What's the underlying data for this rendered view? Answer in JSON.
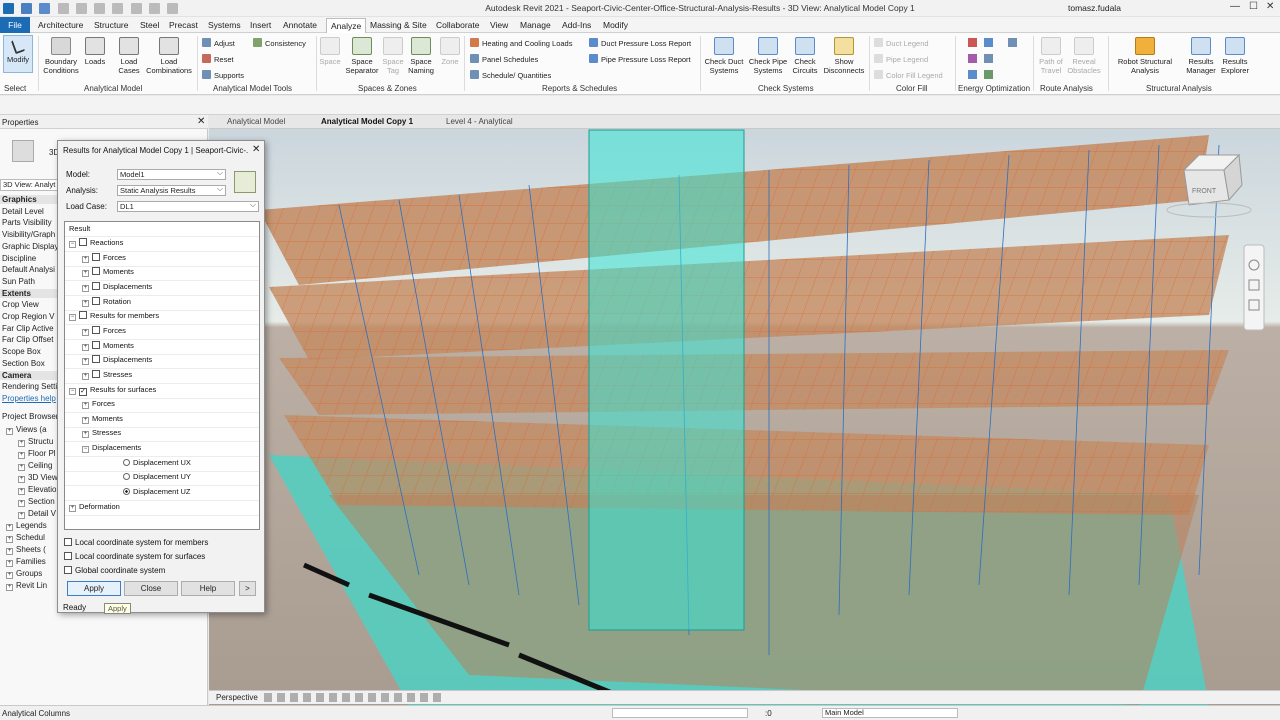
{
  "app_title": "Autodesk Revit 2021 - Seaport-Civic-Center-Office-Structural-Analysis-Results - 3D View: Analytical Model Copy 1",
  "user": "tomasz.fudala",
  "tabs": [
    "File",
    "Architecture",
    "Structure",
    "Steel",
    "Precast",
    "Systems",
    "Insert",
    "Annotate",
    "Analyze",
    "Massing & Site",
    "Collaborate",
    "View",
    "Manage",
    "Add-Ins",
    "Modify"
  ],
  "ribbon": {
    "modify": "Modify",
    "select": "Select",
    "boundary_conditions": "Boundary Conditions",
    "loads": "Loads",
    "load_cases": "Load Cases",
    "load_combinations": "Load Combinations",
    "analytical_model": "Analytical Model",
    "adjust": "Adjust",
    "consistency": "Consistency",
    "reset": "Reset",
    "supports": "Supports",
    "analytical_model_tools": "Analytical Model Tools",
    "space": "Space",
    "space_separator": "Space Separator",
    "space_tag": "Space Tag",
    "space_naming": "Space Naming",
    "zone": "Zone",
    "spaces_zones": "Spaces & Zones",
    "heating_cooling": "Heating and Cooling Loads",
    "panel_schedules": "Panel Schedules",
    "schedule_quantities": "Schedule/ Quantities",
    "duct_pressure": "Duct Pressure Loss Report",
    "pipe_pressure": "Pipe Pressure Loss Report",
    "reports_schedules": "Reports & Schedules",
    "check_duct": "Check Duct Systems",
    "check_pipe": "Check Pipe Systems",
    "check_circuits": "Check Circuits",
    "show_disconnects": "Show Disconnects",
    "check_systems": "Check Systems",
    "duct_legend": "Duct Legend",
    "pipe_legend": "Pipe Legend",
    "color_fill_legend": "Color Fill Legend",
    "color_fill": "Color Fill",
    "energy_optimization": "Energy Optimization",
    "path_of_travel": "Path of Travel",
    "reveal_obstacles": "Reveal Obstacles",
    "route_analysis": "Route Analysis",
    "robot": "Robot Structural Analysis",
    "results_manager": "Results Manager",
    "results_explorer": "Results Explorer",
    "structural_analysis": "Structural Analysis"
  },
  "properties": {
    "title": "Properties",
    "type_label": "3D",
    "selector": "3D View: Analyt",
    "rows": [
      {
        "t": "Graphics",
        "sec": true
      },
      {
        "t": "Detail Level"
      },
      {
        "t": "Parts Visibility"
      },
      {
        "t": "Visibility/Graph"
      },
      {
        "t": "Graphic Display"
      },
      {
        "t": "Discipline"
      },
      {
        "t": "Default Analysi"
      },
      {
        "t": "Sun Path"
      },
      {
        "t": "Extents",
        "sec": true
      },
      {
        "t": "Crop View"
      },
      {
        "t": "Crop Region V"
      },
      {
        "t": "Far Clip Active"
      },
      {
        "t": "Far Clip Offset"
      },
      {
        "t": "Scope Box"
      },
      {
        "t": "Section Box"
      },
      {
        "t": "Camera",
        "sec": true
      },
      {
        "t": "Rendering Setti"
      }
    ],
    "help": "Properties help",
    "browser_title": "Project Browser",
    "browser": [
      {
        "t": "Views (a",
        "lvl": 0
      },
      {
        "t": "Structu",
        "lvl": 1
      },
      {
        "t": "Floor Pl",
        "lvl": 1
      },
      {
        "t": "Ceiling",
        "lvl": 1
      },
      {
        "t": "3D View",
        "lvl": 1
      },
      {
        "t": "Elevatio",
        "lvl": 1
      },
      {
        "t": "Section",
        "lvl": 1
      },
      {
        "t": "Detail V",
        "lvl": 1
      },
      {
        "t": "Legends",
        "lvl": 0
      },
      {
        "t": "Schedul",
        "lvl": 0
      },
      {
        "t": "Sheets (",
        "lvl": 0
      },
      {
        "t": "Families",
        "lvl": 0
      },
      {
        "t": "Groups",
        "lvl": 0
      },
      {
        "t": "Revit Lin",
        "lvl": 0
      }
    ]
  },
  "view_tabs": [
    "Analytical Model",
    "Analytical Model Copy 1",
    "Level 4 - Analytical"
  ],
  "dialog": {
    "title": "Results for Analytical Model Copy 1 | Seaport-Civic-...",
    "model_label": "Model:",
    "model_value": "Model1",
    "analysis_label": "Analysis:",
    "analysis_value": "Static Analysis Results",
    "loadcase_label": "Load Case:",
    "loadcase_value": "DL1",
    "tree_header": "Result",
    "tree": [
      {
        "t": "Reactions",
        "lvl": 0,
        "exp": "-",
        "chk": "0"
      },
      {
        "t": "Forces",
        "lvl": 1,
        "exp": "+",
        "chk": "0"
      },
      {
        "t": "Moments",
        "lvl": 1,
        "exp": "+",
        "chk": "0"
      },
      {
        "t": "Displacements",
        "lvl": 1,
        "exp": "+",
        "chk": "0"
      },
      {
        "t": "Rotation",
        "lvl": 1,
        "exp": "+",
        "chk": "0"
      },
      {
        "t": "Results for members",
        "lvl": 0,
        "exp": "-",
        "chk": "0"
      },
      {
        "t": "Forces",
        "lvl": 1,
        "exp": "+",
        "chk": "0"
      },
      {
        "t": "Moments",
        "lvl": 1,
        "exp": "+",
        "chk": "0"
      },
      {
        "t": "Displacements",
        "lvl": 1,
        "exp": "+",
        "chk": "0"
      },
      {
        "t": "Stresses",
        "lvl": 1,
        "exp": "+",
        "chk": "0"
      },
      {
        "t": "Results for surfaces",
        "lvl": 0,
        "exp": "-",
        "chk": "1"
      },
      {
        "t": "Forces",
        "lvl": 1,
        "exp": "+"
      },
      {
        "t": "Moments",
        "lvl": 1,
        "exp": "+"
      },
      {
        "t": "Stresses",
        "lvl": 1,
        "exp": "+"
      },
      {
        "t": "Displacements",
        "lvl": 1,
        "exp": "-"
      },
      {
        "t": "Displacement UX",
        "lvl": 2,
        "rad": "0"
      },
      {
        "t": "Displacement UY",
        "lvl": 2,
        "rad": "0"
      },
      {
        "t": "Displacement UZ",
        "lvl": 2,
        "rad": "1"
      },
      {
        "t": "Deformation",
        "lvl": 0,
        "exp": "+"
      }
    ],
    "opt_members": "Local coordinate system for members",
    "opt_surfaces": "Local coordinate system for surfaces",
    "opt_global": "Global coordinate system",
    "apply": "Apply",
    "close": "Close",
    "help": "Help",
    "more": ">",
    "status": "Ready",
    "tooltip": "Apply"
  },
  "viewcube_label": "FRONT",
  "view_control": {
    "perspective": "Perspective"
  },
  "status_bar": {
    "left": "Analytical Columns",
    "scale": ":0",
    "model": "Main Model"
  },
  "colors": {
    "accent": "#1c6bb5",
    "slab": "#c98a5e",
    "core": "#2ee0d0",
    "ground": "#4ed0c0"
  }
}
